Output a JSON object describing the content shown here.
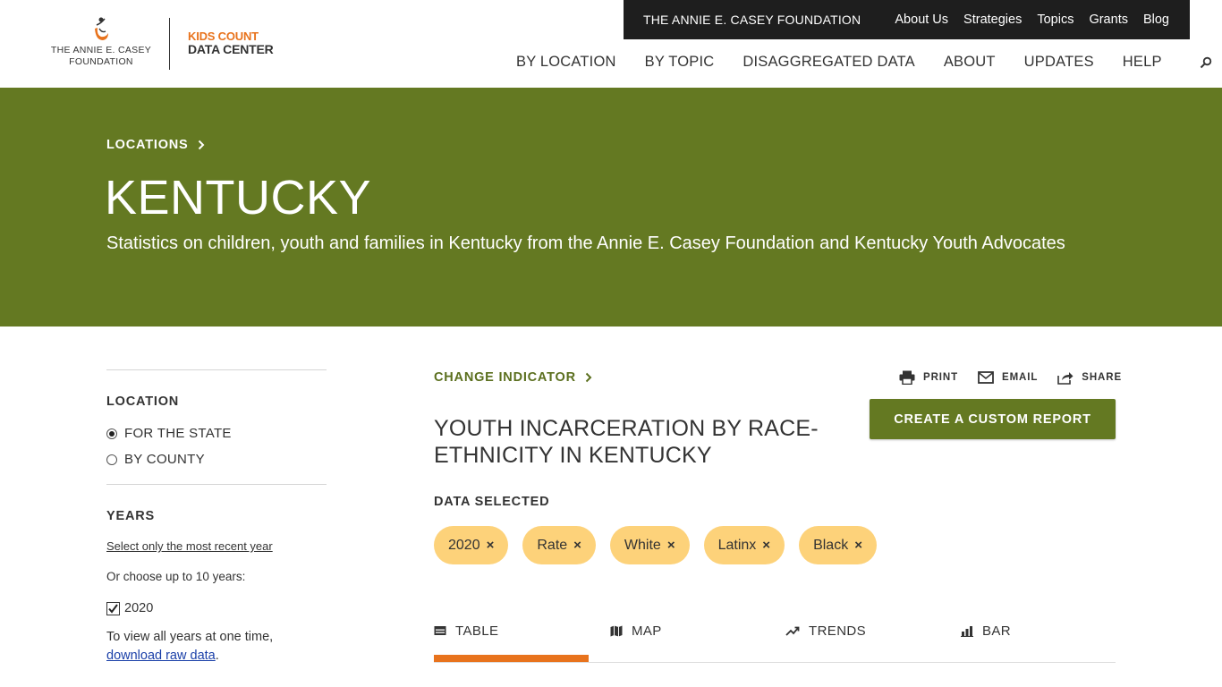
{
  "header": {
    "logo_line1": "THE ANNIE E. CASEY",
    "logo_line2": "FOUNDATION",
    "kids_count": "KIDS COUNT",
    "data_center": "DATA CENTER",
    "topbar_brand": "THE ANNIE E. CASEY FOUNDATION",
    "topbar_links": [
      "About Us",
      "Strategies",
      "Topics",
      "Grants",
      "Blog"
    ],
    "nav": [
      "BY LOCATION",
      "BY TOPIC",
      "DISAGGREGATED DATA",
      "ABOUT",
      "UPDATES",
      "HELP"
    ],
    "search_icon": "search-icon"
  },
  "hero": {
    "breadcrumb": "LOCATIONS",
    "title": "KENTUCKY",
    "subtitle": "Statistics on children, youth and families in Kentucky from the Annie E. Casey Foundation and Kentucky Youth Advocates"
  },
  "sidebar": {
    "location_heading": "LOCATION",
    "location_options": [
      "FOR THE STATE",
      "BY COUNTY"
    ],
    "location_selected": "FOR THE STATE",
    "years_heading": "YEARS",
    "recent_year_link": "Select only the most recent year",
    "choose_text": "Or choose up to 10 years:",
    "years": [
      "2020"
    ],
    "note_text": "To view all years at one time,",
    "note_link": "download raw data",
    "note_end": "."
  },
  "main": {
    "change_indicator": "CHANGE INDICATOR",
    "tools": [
      "PRINT",
      "EMAIL",
      "SHARE"
    ],
    "title": "YOUTH INCARCERATION BY RACE-ETHNICITY IN KENTUCKY",
    "custom_report": "CREATE A CUSTOM REPORT",
    "data_selected_label": "DATA SELECTED",
    "chips": [
      "2020",
      "Rate",
      "White",
      "Latinx",
      "Black"
    ],
    "chip_remove": "×",
    "tabs": [
      "TABLE",
      "MAP",
      "TRENDS",
      "BAR"
    ],
    "active_tab": "TABLE"
  },
  "colors": {
    "brand_green": "#647922",
    "accent_orange": "#e8731d",
    "chip_yellow": "#fdd27a",
    "topbar_black": "#1e1e1e"
  }
}
